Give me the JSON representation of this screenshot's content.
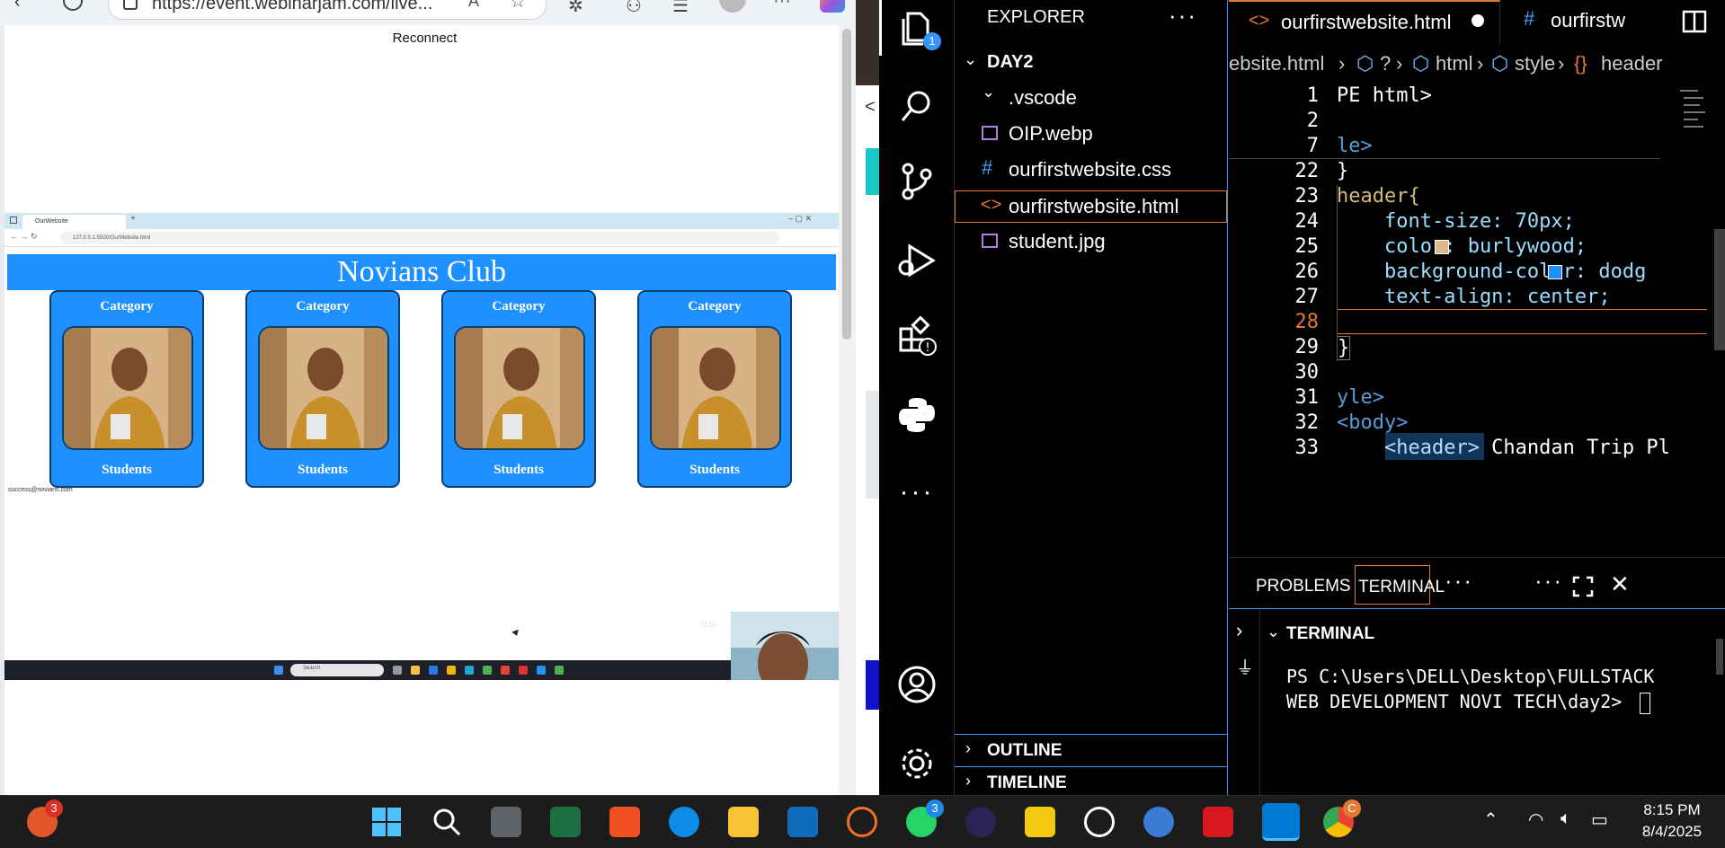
{
  "browser": {
    "url": "https://event.webinarjam.com/live...",
    "reconnect_label": "Reconnect"
  },
  "shared_screen": {
    "tab_title": "OurWebsite",
    "address": "127.0.0.1:5500/OurWebsite.html",
    "site_header": "Novians Club",
    "cards": [
      {
        "title": "Category",
        "footer": "Students"
      },
      {
        "title": "Category",
        "footer": "Students"
      },
      {
        "title": "Category",
        "footer": "Students"
      },
      {
        "title": "Category",
        "footer": "Students"
      }
    ],
    "email": "success@novians.com",
    "taskbar_search": "Search"
  },
  "vscode": {
    "explorer_title": "EXPLORER",
    "folder": "DAY2",
    "files": [
      {
        "name": ".vscode",
        "icon": "chevron-down-icon"
      },
      {
        "name": "OIP.webp",
        "icon": "image-icon"
      },
      {
        "name": "ourfirstwebsite.css",
        "icon": "hash-icon"
      },
      {
        "name": "ourfirstwebsite.html",
        "icon": "code-icon"
      },
      {
        "name": "student.jpg",
        "icon": "image-icon"
      }
    ],
    "outline_label": "OUTLINE",
    "timeline_label": "TIMELINE",
    "activity_badge": "1",
    "tabs": [
      {
        "label": "ourfirstwebsite.html"
      },
      {
        "label": "ourfirstw"
      }
    ],
    "breadcrumb": [
      "ebsite.html",
      "?",
      "html",
      "style",
      "header"
    ],
    "code_lines": [
      {
        "n": "1",
        "text": "PE html>"
      },
      {
        "n": "2",
        "text": ""
      },
      {
        "n": "7",
        "text": "le>"
      },
      {
        "n": "22",
        "text": "}"
      },
      {
        "n": "23",
        "text": "header{"
      },
      {
        "n": "24",
        "text": "    font-size: 70px;"
      },
      {
        "n": "25",
        "text": "    color: burlywood;"
      },
      {
        "n": "26",
        "text": "    background-color: dodg"
      },
      {
        "n": "27",
        "text": "    text-align: center;"
      },
      {
        "n": "28",
        "text": ""
      },
      {
        "n": "29",
        "text": "}"
      },
      {
        "n": "30",
        "text": ""
      },
      {
        "n": "31",
        "text": "yle>"
      },
      {
        "n": "32",
        "text": "<body>"
      },
      {
        "n": "33",
        "text": "    <header> Chandan Trip Pl"
      }
    ],
    "panel_tabs": [
      "PROBLEMS",
      "TERMINAL"
    ],
    "terminal_title": "TERMINAL",
    "terminal_line1": "PS C:\\Users\\DELL\\Desktop\\FULLSTACK",
    "terminal_line2": "WEB DEVELOPMENT NOVI TECH\\day2>",
    "colors": {
      "burlywood": "#deb887",
      "dodgerblue": "#1e90ff",
      "accent": "#3794ff"
    }
  },
  "taskbar": {
    "time": "8:15 PM",
    "date": "8/4/2025",
    "badge_left": "3",
    "badge_whatsapp": "3",
    "badge_chrome": "C"
  }
}
